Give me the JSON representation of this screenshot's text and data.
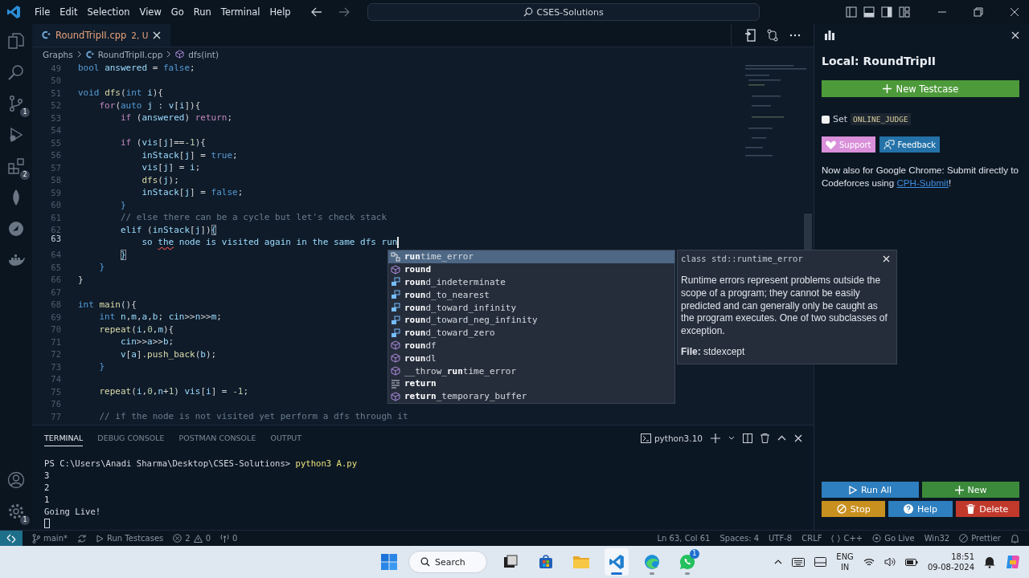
{
  "menu": [
    "File",
    "Edit",
    "Selection",
    "View",
    "Go",
    "Run",
    "Terminal",
    "Help"
  ],
  "command_center": "CSES-Solutions",
  "activity_bar": {
    "source_control_badge": "1",
    "extensions_badge": "2",
    "settings_badge": "1"
  },
  "editor_tab": {
    "title": "RoundTripII.cpp",
    "status": "2, U"
  },
  "breadcrumbs": [
    "Graphs",
    "RoundTripII.cpp",
    "dfs(int)"
  ],
  "code_lines": [
    {
      "number": "49",
      "active": false,
      "tokens": [
        {
          "text": "bool",
          "kind": "kw"
        },
        {
          "text": " answered",
          "kind": "var"
        },
        {
          "text": " = ",
          "kind": "p"
        },
        {
          "text": "false",
          "kind": "kw"
        },
        {
          "text": ";",
          "kind": "p"
        }
      ]
    },
    {
      "number": "50",
      "active": false
    },
    {
      "number": "51",
      "active": false,
      "tokens": [
        {
          "text": "void",
          "kind": "kw"
        },
        {
          "text": " dfs",
          "kind": "fn"
        },
        {
          "text": "(",
          "kind": "p"
        },
        {
          "text": "int",
          "kind": "kw"
        },
        {
          "text": " i",
          "kind": "var"
        },
        {
          "text": "){",
          "kind": "p"
        }
      ]
    },
    {
      "number": "52",
      "active": false,
      "tokens": [
        {
          "text": "    for",
          "kind": "ctl"
        },
        {
          "text": "(",
          "kind": "p"
        },
        {
          "text": "auto",
          "kind": "kw"
        },
        {
          "text": " j",
          "kind": "var"
        },
        {
          "text": " : ",
          "kind": "p"
        },
        {
          "text": "v",
          "kind": "var"
        },
        {
          "text": "[",
          "kind": "p"
        },
        {
          "text": "i",
          "kind": "var"
        },
        {
          "text": "]){",
          "kind": "p"
        }
      ]
    },
    {
      "number": "53",
      "active": false,
      "tokens": [
        {
          "text": "        if",
          "kind": "ctl"
        },
        {
          "text": " (",
          "kind": "p"
        },
        {
          "text": "answered",
          "kind": "var"
        },
        {
          "text": ") ",
          "kind": "p"
        },
        {
          "text": "return",
          "kind": "ctl"
        },
        {
          "text": ";",
          "kind": "p"
        }
      ]
    },
    {
      "number": "54",
      "active": false
    },
    {
      "number": "55",
      "active": false,
      "tokens": [
        {
          "text": "        if",
          "kind": "ctl"
        },
        {
          "text": " (",
          "kind": "p"
        },
        {
          "text": "vis",
          "kind": "var"
        },
        {
          "text": "[",
          "kind": "p"
        },
        {
          "text": "j",
          "kind": "var"
        },
        {
          "text": "]==",
          "kind": "p"
        },
        {
          "text": "-1",
          "kind": "num"
        },
        {
          "text": "){",
          "kind": "p"
        }
      ]
    },
    {
      "number": "56",
      "active": false,
      "tokens": [
        {
          "text": "            inStack",
          "kind": "var"
        },
        {
          "text": "[",
          "kind": "p"
        },
        {
          "text": "j",
          "kind": "var"
        },
        {
          "text": "] = ",
          "kind": "p"
        },
        {
          "text": "true",
          "kind": "kw"
        },
        {
          "text": ";",
          "kind": "p"
        }
      ]
    },
    {
      "number": "57",
      "active": false,
      "tokens": [
        {
          "text": "            vis",
          "kind": "var"
        },
        {
          "text": "[",
          "kind": "p"
        },
        {
          "text": "j",
          "kind": "var"
        },
        {
          "text": "] = ",
          "kind": "p"
        },
        {
          "text": "i",
          "kind": "var"
        },
        {
          "text": ";",
          "kind": "p"
        }
      ]
    },
    {
      "number": "58",
      "active": false,
      "tokens": [
        {
          "text": "            dfs",
          "kind": "fn"
        },
        {
          "text": "(",
          "kind": "p"
        },
        {
          "text": "j",
          "kind": "var"
        },
        {
          "text": ");",
          "kind": "p"
        }
      ]
    },
    {
      "number": "59",
      "active": false,
      "tokens": [
        {
          "text": "            inStack",
          "kind": "var"
        },
        {
          "text": "[",
          "kind": "p"
        },
        {
          "text": "j",
          "kind": "var"
        },
        {
          "text": "] = ",
          "kind": "p"
        },
        {
          "text": "false",
          "kind": "kw"
        },
        {
          "text": ";",
          "kind": "p"
        }
      ]
    },
    {
      "number": "60",
      "active": false,
      "tokens": [
        {
          "text": "        }",
          "kind": "br"
        }
      ]
    },
    {
      "number": "61",
      "active": false,
      "tokens": [
        {
          "text": "        // else there can be a cycle but let's check stack",
          "kind": "com"
        }
      ]
    },
    {
      "number": "62",
      "active": false,
      "tokens": [
        {
          "text": "        elif",
          "kind": "var"
        },
        {
          "text": " (",
          "kind": "p"
        },
        {
          "text": "inStack",
          "kind": "var"
        },
        {
          "text": "[",
          "kind": "p"
        },
        {
          "text": "j",
          "kind": "var"
        },
        {
          "text": "])",
          "kind": "p"
        },
        {
          "text": "{",
          "kind": "match"
        }
      ]
    },
    {
      "number": "63",
      "active": true,
      "tokens": [
        {
          "text": "            so ",
          "kind": "var"
        },
        {
          "text": "the",
          "kind": "err"
        },
        {
          "text": " node is visited again in the same dfs run",
          "kind": "var"
        }
      ]
    },
    {
      "number": "64",
      "active": false,
      "tokens": [
        {
          "text": "        }",
          "kind": "match"
        }
      ]
    },
    {
      "number": "65",
      "active": false,
      "tokens": [
        {
          "text": "    }",
          "kind": "br"
        }
      ]
    },
    {
      "number": "66",
      "active": false,
      "tokens": [
        {
          "text": "}",
          "kind": "p"
        }
      ]
    },
    {
      "number": "67",
      "active": false
    },
    {
      "number": "68",
      "active": false,
      "tokens": [
        {
          "text": "int",
          "kind": "kw"
        },
        {
          "text": " main",
          "kind": "fn"
        },
        {
          "text": "(){",
          "kind": "p"
        }
      ]
    },
    {
      "number": "69",
      "active": false,
      "tokens": [
        {
          "text": "    int",
          "kind": "kw"
        },
        {
          "text": " n",
          "kind": "var"
        },
        {
          "text": ",",
          "kind": "p"
        },
        {
          "text": "m",
          "kind": "var"
        },
        {
          "text": ",",
          "kind": "p"
        },
        {
          "text": "a",
          "kind": "var"
        },
        {
          "text": ",",
          "kind": "p"
        },
        {
          "text": "b",
          "kind": "var"
        },
        {
          "text": "; ",
          "kind": "p"
        },
        {
          "text": "cin",
          "kind": "var"
        },
        {
          "text": ">>",
          "kind": "p"
        },
        {
          "text": "n",
          "kind": "var"
        },
        {
          "text": ">>",
          "kind": "p"
        },
        {
          "text": "m",
          "kind": "var"
        },
        {
          "text": ";",
          "kind": "p"
        }
      ]
    },
    {
      "number": "70",
      "active": false,
      "tokens": [
        {
          "text": "    repeat",
          "kind": "fn"
        },
        {
          "text": "(",
          "kind": "p"
        },
        {
          "text": "i",
          "kind": "var"
        },
        {
          "text": ",",
          "kind": "p"
        },
        {
          "text": "0",
          "kind": "num"
        },
        {
          "text": ",",
          "kind": "p"
        },
        {
          "text": "m",
          "kind": "var"
        },
        {
          "text": "){",
          "kind": "p"
        }
      ]
    },
    {
      "number": "71",
      "active": false,
      "tokens": [
        {
          "text": "        cin",
          "kind": "var"
        },
        {
          "text": ">>",
          "kind": "p"
        },
        {
          "text": "a",
          "kind": "var"
        },
        {
          "text": ">>",
          "kind": "p"
        },
        {
          "text": "b",
          "kind": "var"
        },
        {
          "text": ";",
          "kind": "p"
        }
      ]
    },
    {
      "number": "72",
      "active": false,
      "tokens": [
        {
          "text": "        v",
          "kind": "var"
        },
        {
          "text": "[",
          "kind": "p"
        },
        {
          "text": "a",
          "kind": "var"
        },
        {
          "text": "].",
          "kind": "p"
        },
        {
          "text": "push_back",
          "kind": "fn"
        },
        {
          "text": "(",
          "kind": "p"
        },
        {
          "text": "b",
          "kind": "var"
        },
        {
          "text": ");",
          "kind": "p"
        }
      ]
    },
    {
      "number": "73",
      "active": false,
      "tokens": [
        {
          "text": "    }",
          "kind": "br"
        }
      ]
    },
    {
      "number": "74",
      "active": false
    },
    {
      "number": "75",
      "active": false,
      "tokens": [
        {
          "text": "    repeat",
          "kind": "fn"
        },
        {
          "text": "(",
          "kind": "p"
        },
        {
          "text": "i",
          "kind": "var"
        },
        {
          "text": ",",
          "kind": "p"
        },
        {
          "text": "0",
          "kind": "num"
        },
        {
          "text": ",",
          "kind": "p"
        },
        {
          "text": "n",
          "kind": "var"
        },
        {
          "text": "+",
          "kind": "p"
        },
        {
          "text": "1",
          "kind": "num"
        },
        {
          "text": ") ",
          "kind": "p"
        },
        {
          "text": "vis",
          "kind": "var"
        },
        {
          "text": "[",
          "kind": "p"
        },
        {
          "text": "i",
          "kind": "var"
        },
        {
          "text": "] = ",
          "kind": "p"
        },
        {
          "text": "-1",
          "kind": "num"
        },
        {
          "text": ";",
          "kind": "p"
        }
      ]
    },
    {
      "number": "76",
      "active": false
    },
    {
      "number": "77",
      "active": false,
      "tokens": [
        {
          "text": "    // if the node is not visited yet perform a dfs through it",
          "kind": "com"
        }
      ]
    }
  ],
  "suggestions": [
    {
      "kind": "class",
      "label": "**run**time_error",
      "selected": true
    },
    {
      "kind": "function",
      "label": "**round**",
      "selected": false
    },
    {
      "kind": "enum",
      "label": "**roun**d_indeterminate",
      "selected": false
    },
    {
      "kind": "enum",
      "label": "**roun**d_to_nearest",
      "selected": false
    },
    {
      "kind": "enum",
      "label": "**roun**d_toward_infinity",
      "selected": false
    },
    {
      "kind": "enum",
      "label": "**roun**d_toward_neg_infinity",
      "selected": false
    },
    {
      "kind": "enum",
      "label": "**roun**d_toward_zero",
      "selected": false
    },
    {
      "kind": "function",
      "label": "**roun**df",
      "selected": false
    },
    {
      "kind": "function",
      "label": "**roun**dl",
      "selected": false
    },
    {
      "kind": "function",
      "label": "__throw_**run**time_error",
      "selected": false
    },
    {
      "kind": "keyword",
      "label": "**return**",
      "selected": false
    },
    {
      "kind": "function",
      "label": "**return**_temporary_buffer",
      "selected": false
    }
  ],
  "suggestion_details": {
    "signature": "class std::runtime_error",
    "description": "Runtime errors represent problems outside the scope of a program; they cannot be easily predicted and can generally only be caught as the program executes. One of two subclasses of exception.",
    "file": "**File:** stdexcept"
  },
  "panel": {
    "tabs": [
      {
        "label": "TERMINAL",
        "selected": true
      },
      {
        "label": "DEBUG CONSOLE",
        "selected": false
      },
      {
        "label": "POSTMAN CONSOLE",
        "selected": false
      },
      {
        "label": "OUTPUT",
        "selected": false
      }
    ],
    "shell": "python3.10",
    "prompt": "PS C:\\Users\\Anadi Sharma\\Desktop\\CSES-Solutions>",
    "command": "python3 A.py",
    "output": [
      "3",
      "2",
      "1",
      "Going Live!"
    ]
  },
  "cph": {
    "title": "Local: RoundTripII",
    "new_testcase": "New Testcase",
    "online_judge": {
      "label": "Set",
      "code": "ONLINE_JUDGE",
      "checked": false
    },
    "links": [
      {
        "kind": "heart",
        "label": "Support",
        "color": "#d98fd9"
      },
      {
        "kind": "feedback",
        "label": "Feedback",
        "color": "#2472a8"
      }
    ],
    "notice": "Now also for Google Chrome: Submit directly to Codeforces using",
    "notice_link": "CPH-Submit",
    "notice_end": "!",
    "buttons": [
      {
        "kind": "play",
        "label": "Run All",
        "color": "#2e7fbf"
      },
      {
        "kind": "plus",
        "label": "New",
        "color": "#3b8a3b"
      },
      {
        "kind": "stop",
        "label": "Stop",
        "color": "#c8901f"
      },
      {
        "kind": "help",
        "label": "Help",
        "color": "#2e7fbf"
      },
      {
        "kind": "trash",
        "label": "Delete",
        "color": "#c0392b"
      }
    ]
  },
  "status_bar": {
    "branch": "main*",
    "run_testcases": "Run Testcases",
    "errors": "2",
    "warnings": "0",
    "ports": "0",
    "position": "Ln 63, Col 61",
    "spaces": "Spaces: 4",
    "encoding": "UTF-8",
    "eol": "CRLF",
    "language": "C++",
    "go_live": "Go Live",
    "platform": "Win32",
    "formatter": "Prettier"
  },
  "taskbar": {
    "search": "Search",
    "apps": [
      {
        "kind": "task-view",
        "selected": false,
        "running": false
      },
      {
        "kind": "store",
        "selected": false,
        "running": false
      },
      {
        "kind": "folder",
        "selected": false,
        "running": false
      },
      {
        "kind": "editor",
        "selected": true,
        "running": true
      },
      {
        "kind": "browser",
        "selected": false,
        "running": true
      },
      {
        "kind": "chat",
        "selected": false,
        "running": true,
        "badge": "1"
      }
    ],
    "language": "ENG",
    "region": "IN",
    "time": "18:51",
    "date": "09-08-2024"
  }
}
